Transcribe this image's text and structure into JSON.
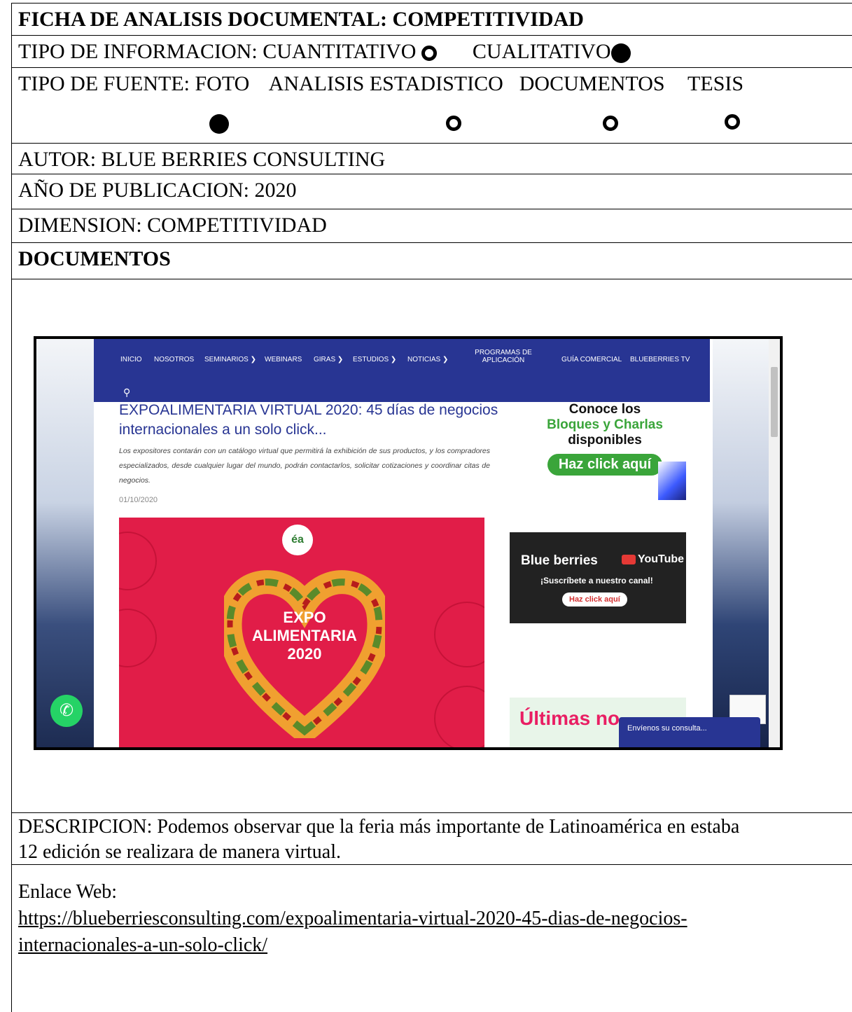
{
  "sheet": {
    "title": "FICHA DE ANALISIS DOCUMENTAL: COMPETITIVIDAD",
    "info_type_label": "TIPO DE INFORMACION:",
    "info_options": [
      {
        "label": "CUANTITATIVO",
        "selected": false
      },
      {
        "label": "CUALITATIVO",
        "selected": true
      }
    ],
    "source_type_label": "TIPO DE FUENTE:",
    "source_options": [
      {
        "label": "FOTO",
        "selected": true
      },
      {
        "label": "ANALISIS ESTADISTICO",
        "selected": false
      },
      {
        "label": "DOCUMENTOS",
        "selected": false
      },
      {
        "label": "TESIS",
        "selected": false
      }
    ],
    "author": "AUTOR: BLUE BERRIES CONSULTING",
    "year": "AÑO DE PUBLICACION: 2020",
    "dimension": "DIMENSION: COMPETITIVIDAD",
    "documents_heading": "DOCUMENTOS",
    "description_line1": "DESCRIPCION: Podemos observar que la feria más importante de Latinoamérica en estaba",
    "description_line2": "12 edición se realizara de manera virtual.",
    "web_label": "Enlace Web:",
    "url_line1": "https://blueberriesconsulting.com/expoalimentaria-virtual-2020-45-dias-de-negocios-",
    "url_line2": "internacionales-a-un-solo-click/"
  },
  "screenshot": {
    "nav": [
      "INICIO",
      "NOSOTROS",
      "SEMINARIOS ❯",
      "WEBINARS",
      "GIRAS ❯",
      "ESTUDIOS ❯",
      "NOTICIAS ❯",
      "PROGRAMAS DE APLICACIÓN",
      "GUÍA COMERCIAL",
      "BLUEBERRIES TV"
    ],
    "article_title": "EXPOALIMENTARIA VIRTUAL 2020: 45 días de negocios internacionales a un solo click...",
    "article_desc": "Los expositores contarán con un catálogo virtual que permitirá la exhibición de sus productos, y los compradores especializados, desde cualquier lugar del mundo, podrán contactarlos, solicitar cotizaciones y coordinar citas de negocios.",
    "article_date": "01/10/2020",
    "hero_logo": "éa",
    "hero_text": "EXPO ALIMENTARIA 2020",
    "side_t1": "Conoce los",
    "side_t2": "Bloques y Charlas",
    "side_t3": "disponibles",
    "side_btn": "Haz click aquí",
    "yt_brand": "Blue berries",
    "yt_logo": "YouTube",
    "yt_sub": "¡Suscríbete a nuestro canal!",
    "yt_btn": "Haz click aquí",
    "news_title": "Últimas no",
    "consult": "Envíenos su consulta..."
  }
}
